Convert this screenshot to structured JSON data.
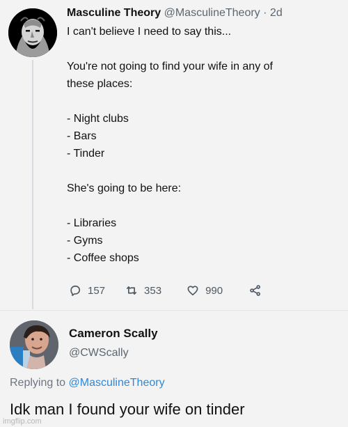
{
  "tweet": {
    "author": {
      "display_name": "Masculine Theory",
      "handle": "@MasculineTheory",
      "separator": "·",
      "time": "2d"
    },
    "lines": [
      "I can't believe I need to say this...",
      "",
      "You're not going to find your wife in any of",
      "these places:",
      "",
      "- Night clubs",
      "- Bars",
      "- Tinder",
      "",
      "She's going to be here:",
      "",
      "- Libraries",
      "- Gyms",
      "- Coffee shops"
    ],
    "actions": {
      "reply_count": "157",
      "retweet_count": "353",
      "like_count": "990",
      "reply_icon": "reply-icon",
      "retweet_icon": "retweet-icon",
      "like_icon": "heart-icon",
      "share_icon": "share-icon"
    }
  },
  "reply": {
    "author": {
      "display_name": "Cameron Scally",
      "handle": "@CWScally"
    },
    "replying_to_prefix": "Replying to ",
    "replying_to_handle": "@MasculineTheory",
    "text": "Idk man I found your wife on tinder"
  },
  "watermark": "imgflip.com",
  "colors": {
    "background": "#f3f3f3",
    "text": "#111111",
    "muted": "#5b6670",
    "accent": "#2f87d6",
    "thread_line": "#d7dbe0"
  }
}
